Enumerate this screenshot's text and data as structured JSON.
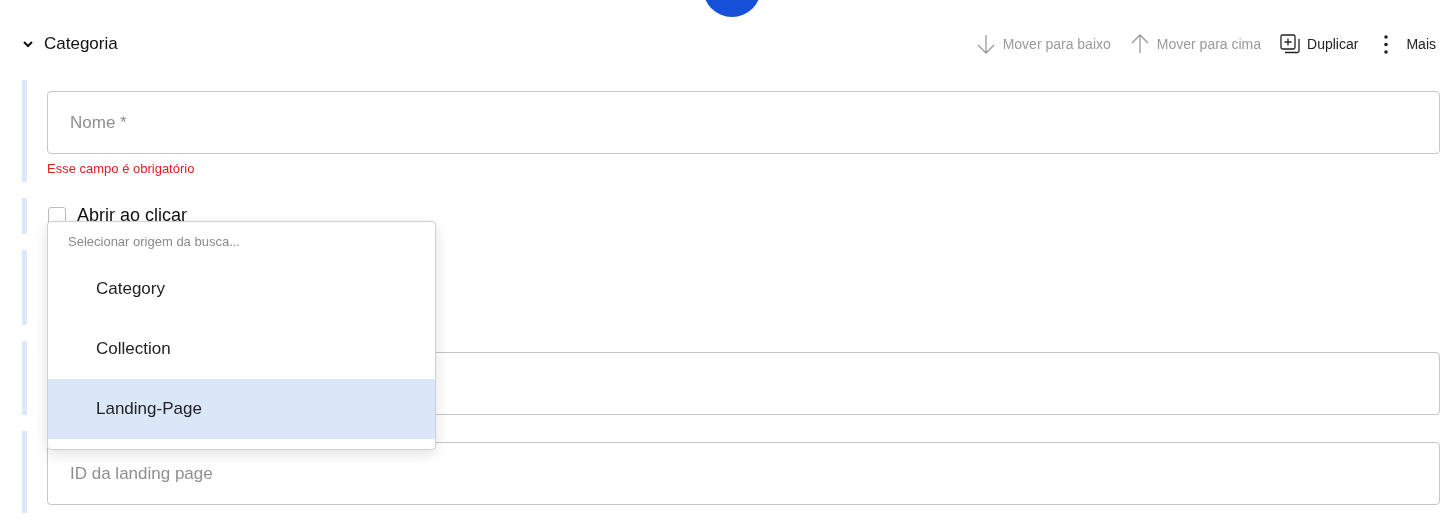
{
  "header": {
    "title": "Categoria",
    "expanded": true
  },
  "actions": [
    {
      "kind": "move-down",
      "label": "Mover para baixo",
      "disabled": true
    },
    {
      "kind": "move-up",
      "label": "Mover para cima",
      "disabled": true
    },
    {
      "kind": "duplicate",
      "label": "Duplicar",
      "disabled": false
    },
    {
      "kind": "more",
      "label": "Mais",
      "disabled": false
    }
  ],
  "fields": [
    {
      "kind": "text",
      "placeholder": "Nome *",
      "error": "Esse campo é obrigatório"
    },
    {
      "kind": "checkbox",
      "label": "Abrir ao clicar",
      "checked": false
    },
    {
      "kind": "blank"
    },
    {
      "kind": "text"
    },
    {
      "kind": "text",
      "placeholder": "ID da landing page"
    }
  ],
  "dropdown": {
    "placeholder": "Selecionar origem da busca...",
    "options": [
      {
        "label": "Category",
        "selected": false
      },
      {
        "label": "Collection",
        "selected": false
      },
      {
        "label": "Landing-Page",
        "selected": true
      }
    ]
  }
}
